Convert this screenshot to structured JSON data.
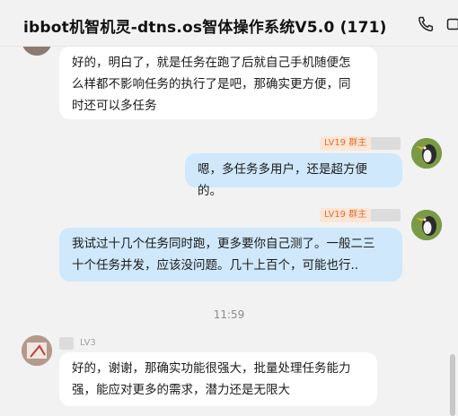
{
  "header": {
    "title": "ibbot机智机灵-dtns.os智体操作系统V5.0 (171)",
    "phone_icon": "phone-icon",
    "video_icon": "video-icon"
  },
  "messages": [
    {
      "side": "left",
      "lines": [
        "好的，明白了，就是任务在跑了后就自己手机随便怎",
        "么样都不影响任务的执行了是吧，那确实更方便，同",
        "时还可以多任务"
      ]
    },
    {
      "side": "right",
      "badge": "LV19 群主",
      "lines": [
        "嗯，多任务多用户，还是超方便的。"
      ]
    },
    {
      "side": "right",
      "badge": "LV19 群主",
      "lines": [
        "我试过十几个任务同时跑，更多要你自己测了。一般二三",
        "十个任务并发，应该没问题。几十上百个，可能也行.."
      ]
    },
    {
      "side": "left",
      "badge": "LV3",
      "lines": [
        "好的，谢谢，那确实功能很强大，批量处理任务能力",
        "强，能应对更多的需求，潜力还是无限大"
      ]
    }
  ],
  "time_divider": "11:59",
  "colors": {
    "background": "#f2f2f2",
    "bubble_left": "#ffffff",
    "bubble_right": "#cfe8fb",
    "owner_badge_bg": "#fde6d5",
    "owner_badge_text": "#e36f2c"
  }
}
